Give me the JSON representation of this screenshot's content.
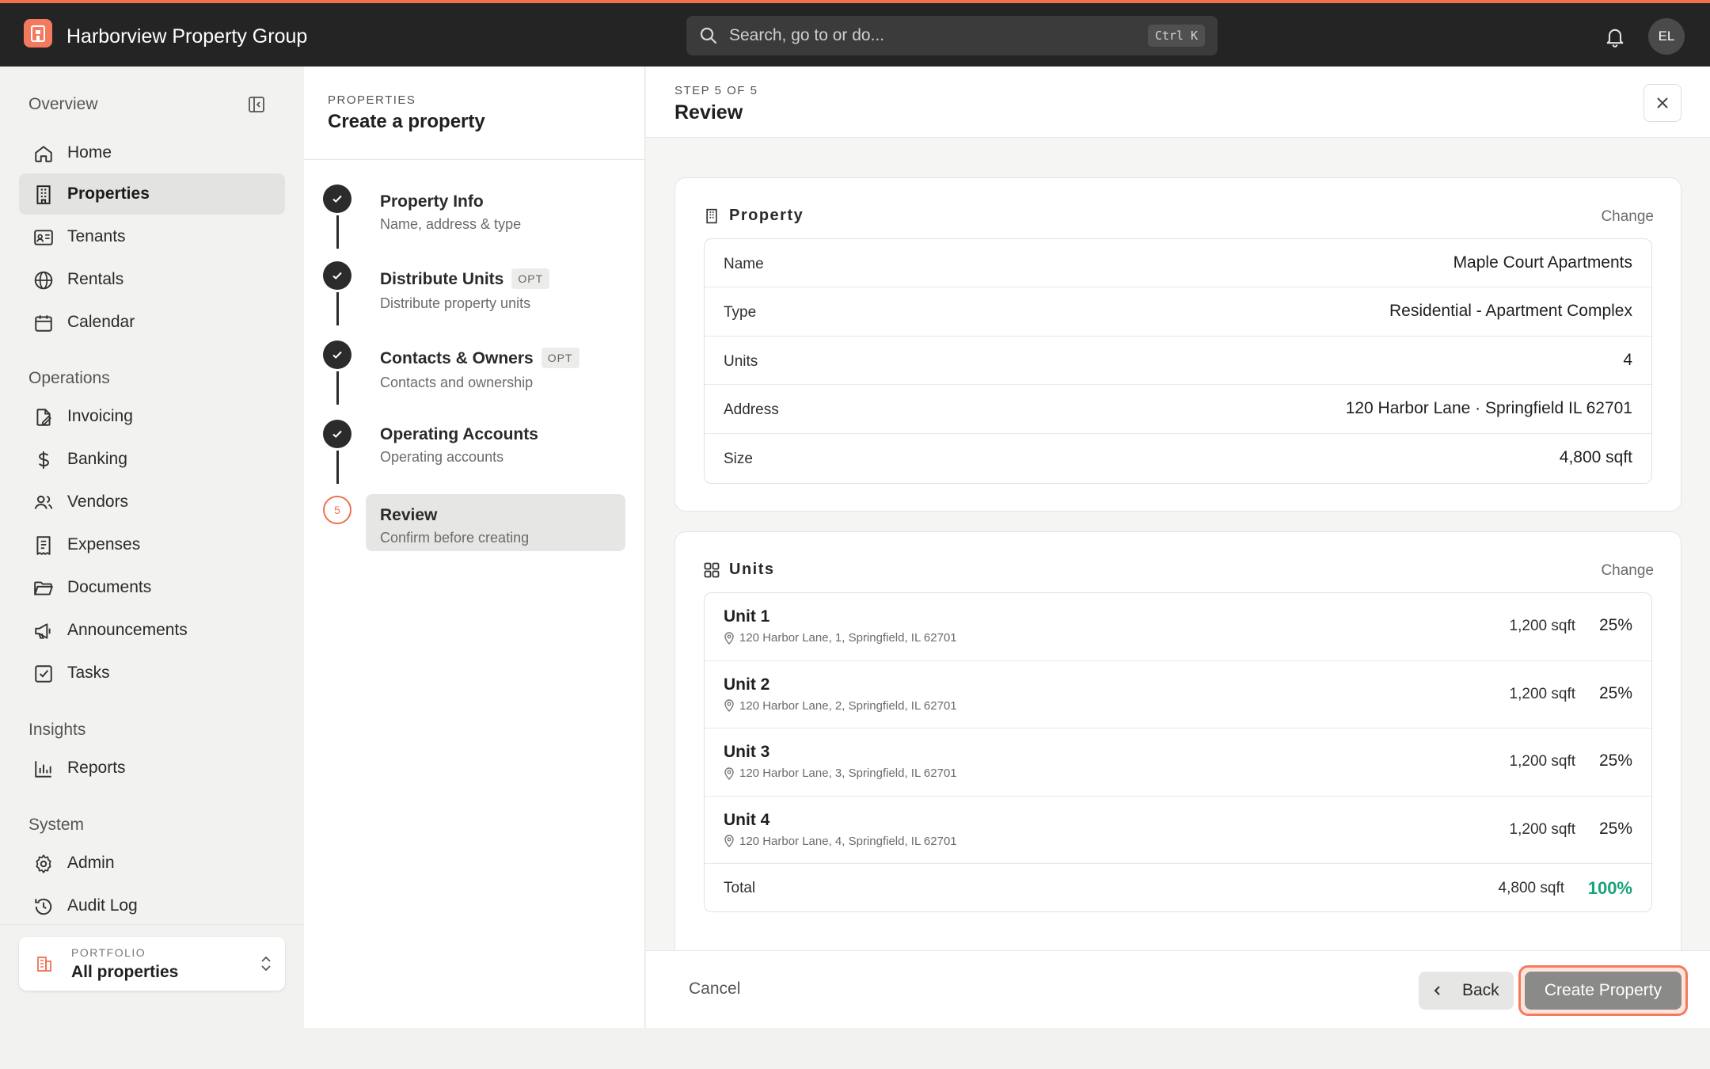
{
  "app": {
    "title": "Harborview Property Group",
    "accent": "#f0704f"
  },
  "search": {
    "placeholder": "Search, go to or do...",
    "shortcut": "Ctrl K"
  },
  "user": {
    "initials": "EL"
  },
  "sidebar": {
    "overview_heading": "Overview",
    "overview_items": [
      {
        "label": "Home",
        "icon": "home-icon"
      },
      {
        "label": "Properties",
        "icon": "building-icon",
        "active": true
      },
      {
        "label": "Tenants",
        "icon": "id-card-icon"
      },
      {
        "label": "Rentals",
        "icon": "globe-icon"
      },
      {
        "label": "Calendar",
        "icon": "calendar-icon"
      }
    ],
    "operations_heading": "Operations",
    "operations_items": [
      {
        "label": "Invoicing",
        "icon": "invoice-icon"
      },
      {
        "label": "Banking",
        "icon": "dollar-icon"
      },
      {
        "label": "Vendors",
        "icon": "users-icon"
      },
      {
        "label": "Expenses",
        "icon": "receipt-icon"
      },
      {
        "label": "Documents",
        "icon": "folder-icon"
      },
      {
        "label": "Announcements",
        "icon": "megaphone-icon"
      },
      {
        "label": "Tasks",
        "icon": "checkbox-icon"
      }
    ],
    "insights_heading": "Insights",
    "insights_items": [
      {
        "label": "Reports",
        "icon": "bar-chart-icon"
      }
    ],
    "system_heading": "System",
    "system_items": [
      {
        "label": "Admin",
        "icon": "gear-icon"
      },
      {
        "label": "Audit Log",
        "icon": "history-icon"
      }
    ],
    "portfolio": {
      "label": "PORTFOLIO",
      "value": "All properties"
    }
  },
  "stepper": {
    "eyebrow": "PROPERTIES",
    "title": "Create a property",
    "opt_label": "OPT",
    "current_number": "5",
    "steps": [
      {
        "title": "Property Info",
        "subtitle": "Name, address & type"
      },
      {
        "title": "Distribute Units",
        "subtitle": "Distribute property units"
      },
      {
        "title": "Contacts & Owners",
        "subtitle": "Contacts and ownership"
      },
      {
        "title": "Operating Accounts",
        "subtitle": "Operating accounts"
      },
      {
        "title": "Review",
        "subtitle": "Confirm before creating"
      }
    ]
  },
  "main": {
    "eyebrow": "STEP 5 OF 5",
    "title": "Review",
    "property_card": {
      "title": "Property",
      "change_label": "Change",
      "rows": [
        {
          "key": "Name",
          "value": "Maple Court Apartments"
        },
        {
          "key": "Type",
          "value": "Residential - Apartment Complex"
        },
        {
          "key": "Units",
          "value": "4"
        },
        {
          "key": "Address",
          "value": "120 Harbor Lane · Springfield IL 62701"
        },
        {
          "key": "Size",
          "value": "4,800 sqft"
        }
      ]
    },
    "units_card": {
      "title": "Units",
      "change_label": "Change",
      "units": [
        {
          "name": "Unit 1",
          "address": "120 Harbor Lane, 1, Springfield, IL 62701",
          "size": "1,200 sqft",
          "pct": "25%"
        },
        {
          "name": "Unit 2",
          "address": "120 Harbor Lane, 2, Springfield, IL 62701",
          "size": "1,200 sqft",
          "pct": "25%"
        },
        {
          "name": "Unit 3",
          "address": "120 Harbor Lane, 3, Springfield, IL 62701",
          "size": "1,200 sqft",
          "pct": "25%"
        },
        {
          "name": "Unit 4",
          "address": "120 Harbor Lane, 4, Springfield, IL 62701",
          "size": "1,200 sqft",
          "pct": "25%"
        }
      ],
      "total": {
        "label": "Total",
        "size": "4,800 sqft",
        "pct": "100%"
      }
    },
    "footer": {
      "cancel_label": "Cancel",
      "back_label": "Back",
      "create_label": "Create Property"
    }
  }
}
